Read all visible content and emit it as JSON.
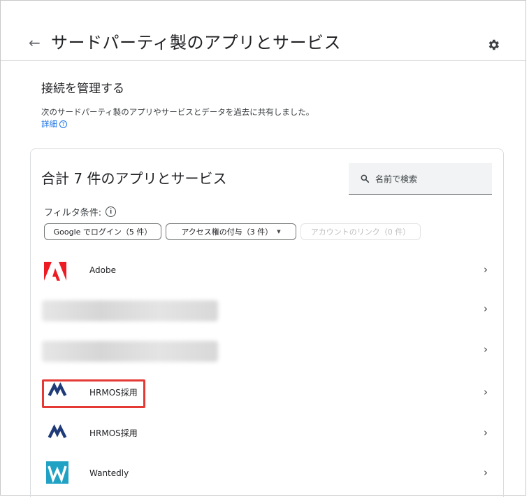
{
  "header": {
    "back_arrow": "←",
    "title": "サードパーティ製のアプリとサービス",
    "settings_icon": "gear-icon"
  },
  "intro": {
    "heading": "接続を管理する",
    "description": "次のサードパーティ製のアプリやサービスとデータを過去に共有しました。",
    "learn_more": "詳細",
    "help_glyph": "?"
  },
  "apps_card": {
    "count_heading": "合計 7 件のアプリとサービス",
    "search_placeholder": "名前で検索",
    "filter_label": "フィルタ条件:",
    "info_glyph": "i",
    "chips": [
      {
        "label": "Google でログイン（5 件）",
        "enabled": true
      },
      {
        "label": "アクセス権の付与（3 件）",
        "enabled": true,
        "caret": "▼"
      },
      {
        "label": "アカウントのリンク（0 件）",
        "enabled": false
      }
    ],
    "chevron": "›",
    "rows": [
      {
        "name": "Adobe",
        "icon": "adobe-logo-icon"
      },
      {
        "name": "",
        "icon": "blurred-app",
        "blurred": true
      },
      {
        "name": "",
        "icon": "blurred-app",
        "blurred": true
      },
      {
        "name": "HRMOS採用",
        "icon": "hrmos-logo-icon"
      },
      {
        "name": "HRMOS採用",
        "icon": "hrmos-logo-icon"
      },
      {
        "name": "Wantedly",
        "icon": "wantedly-logo-icon"
      }
    ]
  },
  "colors": {
    "adobe_red": "#ed1c24",
    "hrmos_navy": "#1f3a78",
    "wantedly_teal": "#21a2c4",
    "link_blue": "#1a73e8",
    "highlight_red": "#e53935"
  }
}
